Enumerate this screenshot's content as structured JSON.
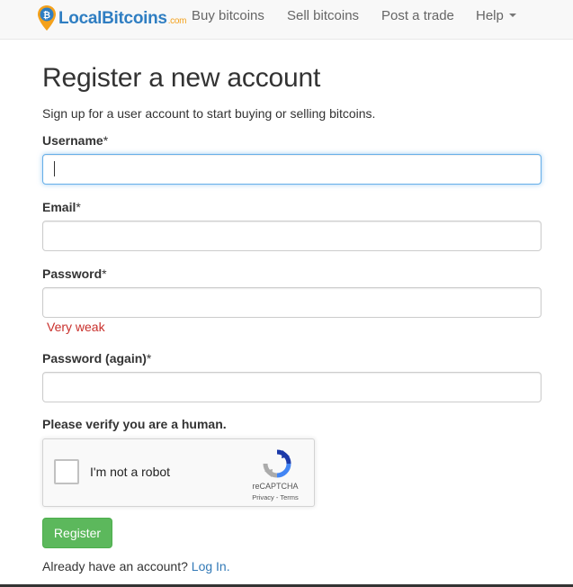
{
  "navbar": {
    "brand_name": "LocalBitcoins",
    "brand_suffix": ".com",
    "items": [
      {
        "label": "Buy bitcoins"
      },
      {
        "label": "Sell bitcoins"
      },
      {
        "label": "Post a trade"
      },
      {
        "label": "Help"
      }
    ]
  },
  "page": {
    "title": "Register a new account",
    "subtitle": "Sign up for a user account to start buying or selling bitcoins."
  },
  "form": {
    "username_label": "Username",
    "email_label": "Email",
    "password_label": "Password",
    "password_again_label": "Password (again)",
    "required_mark": "*",
    "username_value": "",
    "email_value": "",
    "password_value": "",
    "password_again_value": "",
    "password_strength": "Very weak",
    "human_label": "Please verify you are a human."
  },
  "recaptcha": {
    "checkbox_label": "I'm not a robot",
    "brand": "reCAPTCHA",
    "privacy": "Privacy",
    "separator": " - ",
    "terms": "Terms"
  },
  "actions": {
    "register_label": "Register",
    "already_text": "Already have an account?",
    "login_link": "Log In."
  },
  "colors": {
    "brand_blue": "#2f7ec2",
    "brand_orange": "#f4a11b",
    "register_green": "#5cb85c",
    "link_blue": "#337ab7",
    "weak_red": "#c9302c",
    "focus_blue": "#66afe9"
  }
}
